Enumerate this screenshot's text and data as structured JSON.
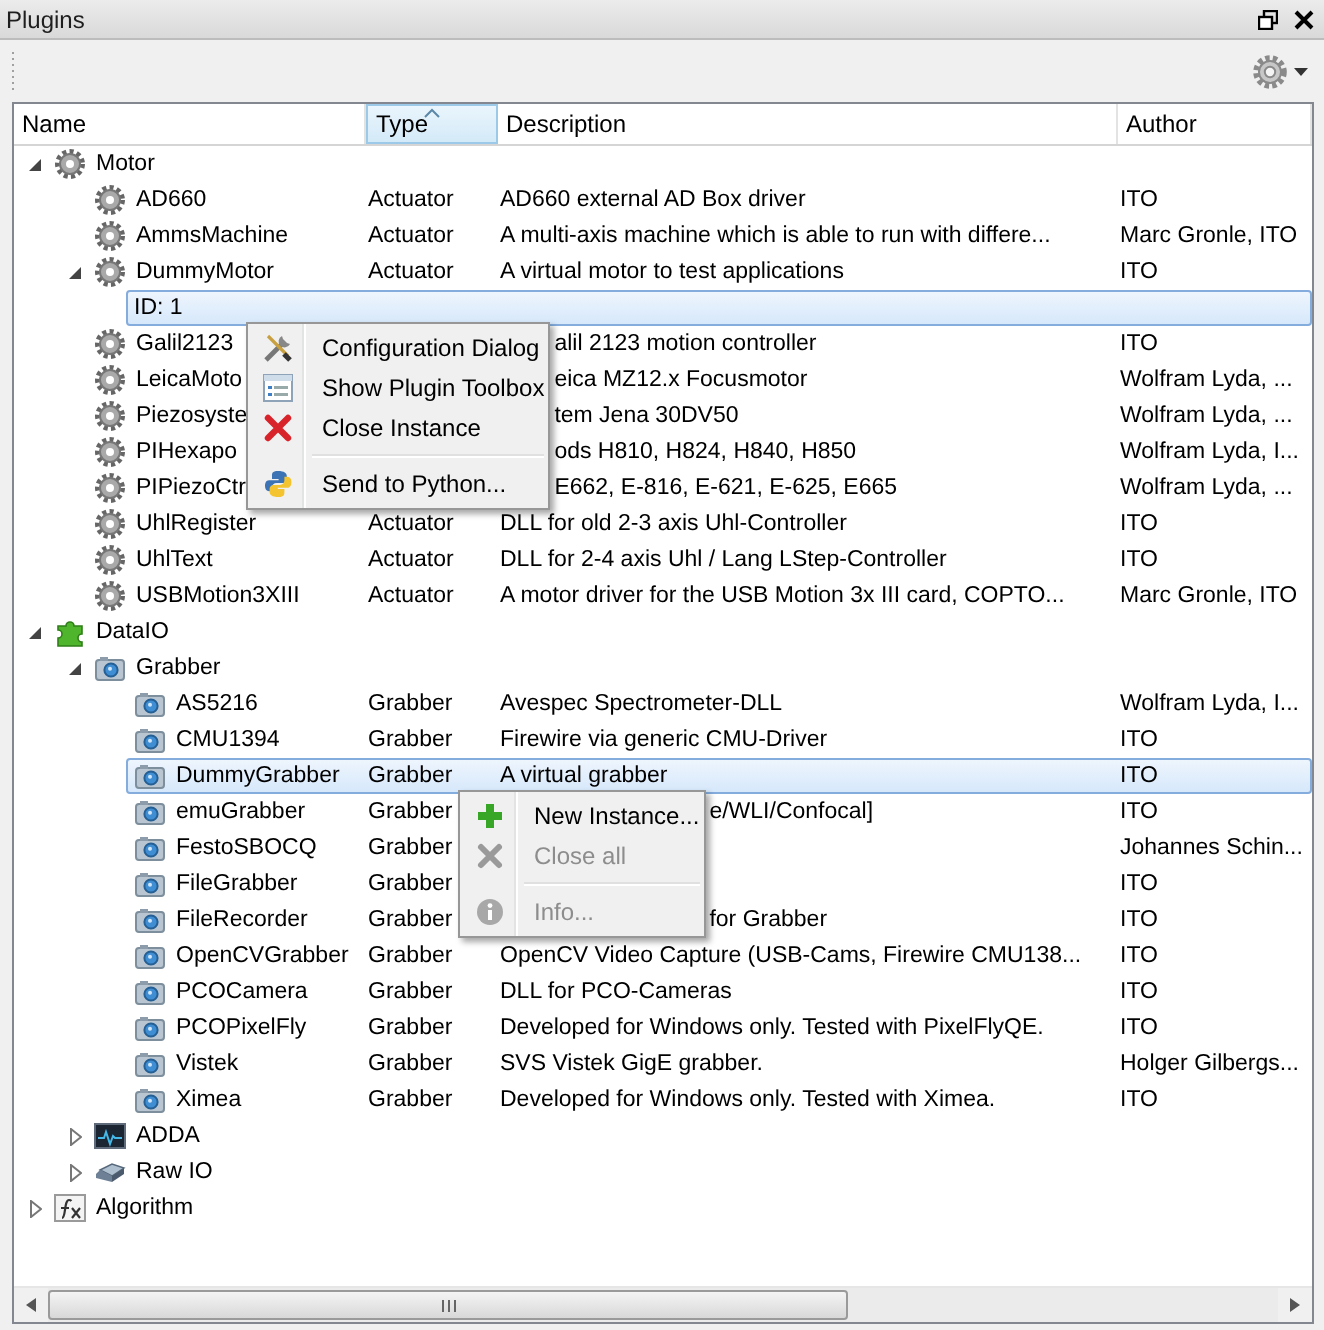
{
  "panel": {
    "title": "Plugins"
  },
  "tree": {
    "columns": [
      {
        "label": "Name",
        "sorted": false
      },
      {
        "label": "Type",
        "sorted": true
      },
      {
        "label": "Description",
        "sorted": false
      },
      {
        "label": "Author",
        "sorted": false
      }
    ],
    "items": [
      {
        "kind": "actuator-group",
        "name": "Motor",
        "selected": false,
        "expanded": true,
        "children": [
          {
            "kind": "actuator",
            "name": "AD660",
            "type": "Actuator",
            "description": "AD660 external AD Box driver",
            "author": "ITO",
            "selected": false
          },
          {
            "kind": "actuator",
            "name": "AmmsMachine",
            "type": "Actuator",
            "description": "A multi-axis machine which is able to run with differe...",
            "author": "Marc Gronle, ITO",
            "selected": false
          },
          {
            "kind": "actuator",
            "name": "DummyMotor",
            "type": "Actuator",
            "description": "A virtual motor to test applications",
            "author": "ITO",
            "selected": false,
            "expanded": true,
            "children": [
              {
                "kind": "instance",
                "name": "ID: 1",
                "selected": true,
                "context_menu": {
                  "items": [
                    {
                      "kind": "action",
                      "label": "Configuration Dialog",
                      "disabled": false
                    },
                    {
                      "kind": "action",
                      "label": "Show Plugin Toolbox",
                      "disabled": false
                    },
                    {
                      "kind": "action",
                      "label": "Close Instance",
                      "disabled": false
                    },
                    {
                      "kind": "separator"
                    },
                    {
                      "kind": "action",
                      "label": "Send to Python...",
                      "disabled": false
                    }
                  ]
                }
              }
            ]
          },
          {
            "kind": "actuator",
            "name": "Galil2123",
            "description": "alil 2123 motion controller",
            "author": "ITO",
            "selected": false
          },
          {
            "kind": "actuator",
            "name": "LeicaMoto",
            "description": "eica MZ12.x Focusmotor",
            "author": "Wolfram Lyda, ...",
            "selected": false
          },
          {
            "kind": "actuator",
            "name": "Piezosyste",
            "description": "tem Jena 30DV50",
            "author": "Wolfram Lyda, ...",
            "selected": false
          },
          {
            "kind": "actuator",
            "name": "PIHexapo",
            "description": "ods H810, H824, H840, H850",
            "author": "Wolfram Lyda, I...",
            "selected": false
          },
          {
            "kind": "actuator",
            "name": "PIPiezoCtr",
            "description": "E662, E-816, E-621, E-625, E665",
            "author": "Wolfram Lyda, ...",
            "selected": false
          },
          {
            "kind": "actuator",
            "name": "UhlRegister",
            "type": "Actuator",
            "description": "DLL for old 2-3 axis Uhl-Controller",
            "author": "ITO",
            "selected": false
          },
          {
            "kind": "actuator",
            "name": "UhlText",
            "type": "Actuator",
            "description": "DLL for 2-4 axis Uhl / Lang LStep-Controller",
            "author": "ITO",
            "selected": false
          },
          {
            "kind": "actuator",
            "name": "USBMotion3XIII",
            "type": "Actuator",
            "description": "A motor driver for the USB Motion 3x III card, COPTO...",
            "author": "Marc Gronle, ITO",
            "selected": false
          }
        ]
      },
      {
        "kind": "dataio-group",
        "name": "DataIO",
        "selected": false,
        "expanded": true,
        "children": [
          {
            "kind": "grabber-group",
            "name": "Grabber",
            "selected": false,
            "expanded": true,
            "children": [
              {
                "kind": "grabber",
                "name": "AS5216",
                "type": "Grabber",
                "description": "Avespec Spectrometer-DLL",
                "author": "Wolfram Lyda, I...",
                "selected": false
              },
              {
                "kind": "grabber",
                "name": "CMU1394",
                "type": "Grabber",
                "description": "Firewire via generic CMU-Driver",
                "author": "ITO",
                "selected": false
              },
              {
                "kind": "grabber",
                "name": "DummyGrabber",
                "type": "Grabber",
                "description": "A virtual grabber",
                "author": "ITO",
                "selected": true,
                "context_menu": {
                  "items": [
                    {
                      "kind": "action",
                      "label": "New Instance...",
                      "disabled": false
                    },
                    {
                      "kind": "action",
                      "label": "Close all",
                      "disabled": true
                    },
                    {
                      "kind": "separator"
                    },
                    {
                      "kind": "action",
                      "label": "Info...",
                      "disabled": true
                    }
                  ]
                }
              },
              {
                "kind": "grabber",
                "name": "emuGrabber",
                "type": "Grabber",
                "description": "e/WLI/Confocal]",
                "author": "ITO",
                "selected": false
              },
              {
                "kind": "grabber",
                "name": "FestoSBOCQ",
                "type": "Grabber",
                "author": "Johannes Schin...",
                "selected": false
              },
              {
                "kind": "grabber",
                "name": "FileGrabber",
                "type": "Grabber",
                "author": "ITO",
                "selected": false
              },
              {
                "kind": "grabber",
                "name": "FileRecorder",
                "type": "Grabber",
                "description": "for Grabber",
                "author": "ITO",
                "selected": false
              },
              {
                "kind": "grabber",
                "name": "OpenCVGrabber",
                "type": "Grabber",
                "description": "OpenCV Video Capture (USB-Cams, Firewire CMU138...",
                "author": "ITO",
                "selected": false
              },
              {
                "kind": "grabber",
                "name": "PCOCamera",
                "type": "Grabber",
                "description": "DLL for PCO-Cameras",
                "author": "ITO",
                "selected": false
              },
              {
                "kind": "grabber",
                "name": "PCOPixelFly",
                "type": "Grabber",
                "description": "Developed for Windows only. Tested with PixelFlyQE.",
                "author": "ITO",
                "selected": false
              },
              {
                "kind": "grabber",
                "name": "Vistek",
                "type": "Grabber",
                "description": "SVS Vistek GigE grabber.",
                "author": "Holger Gilbergs...",
                "selected": false
              },
              {
                "kind": "grabber",
                "name": "Ximea",
                "type": "Grabber",
                "description": "Developed for Windows only. Tested with Ximea.",
                "author": "ITO",
                "selected": false
              }
            ]
          },
          {
            "kind": "adda-group",
            "name": "ADDA",
            "selected": false,
            "expanded": false
          },
          {
            "kind": "rawio-group",
            "name": "Raw IO",
            "selected": false,
            "expanded": false
          }
        ]
      },
      {
        "kind": "algorithm-group",
        "name": "Algorithm",
        "selected": false,
        "expanded": false
      }
    ]
  }
}
